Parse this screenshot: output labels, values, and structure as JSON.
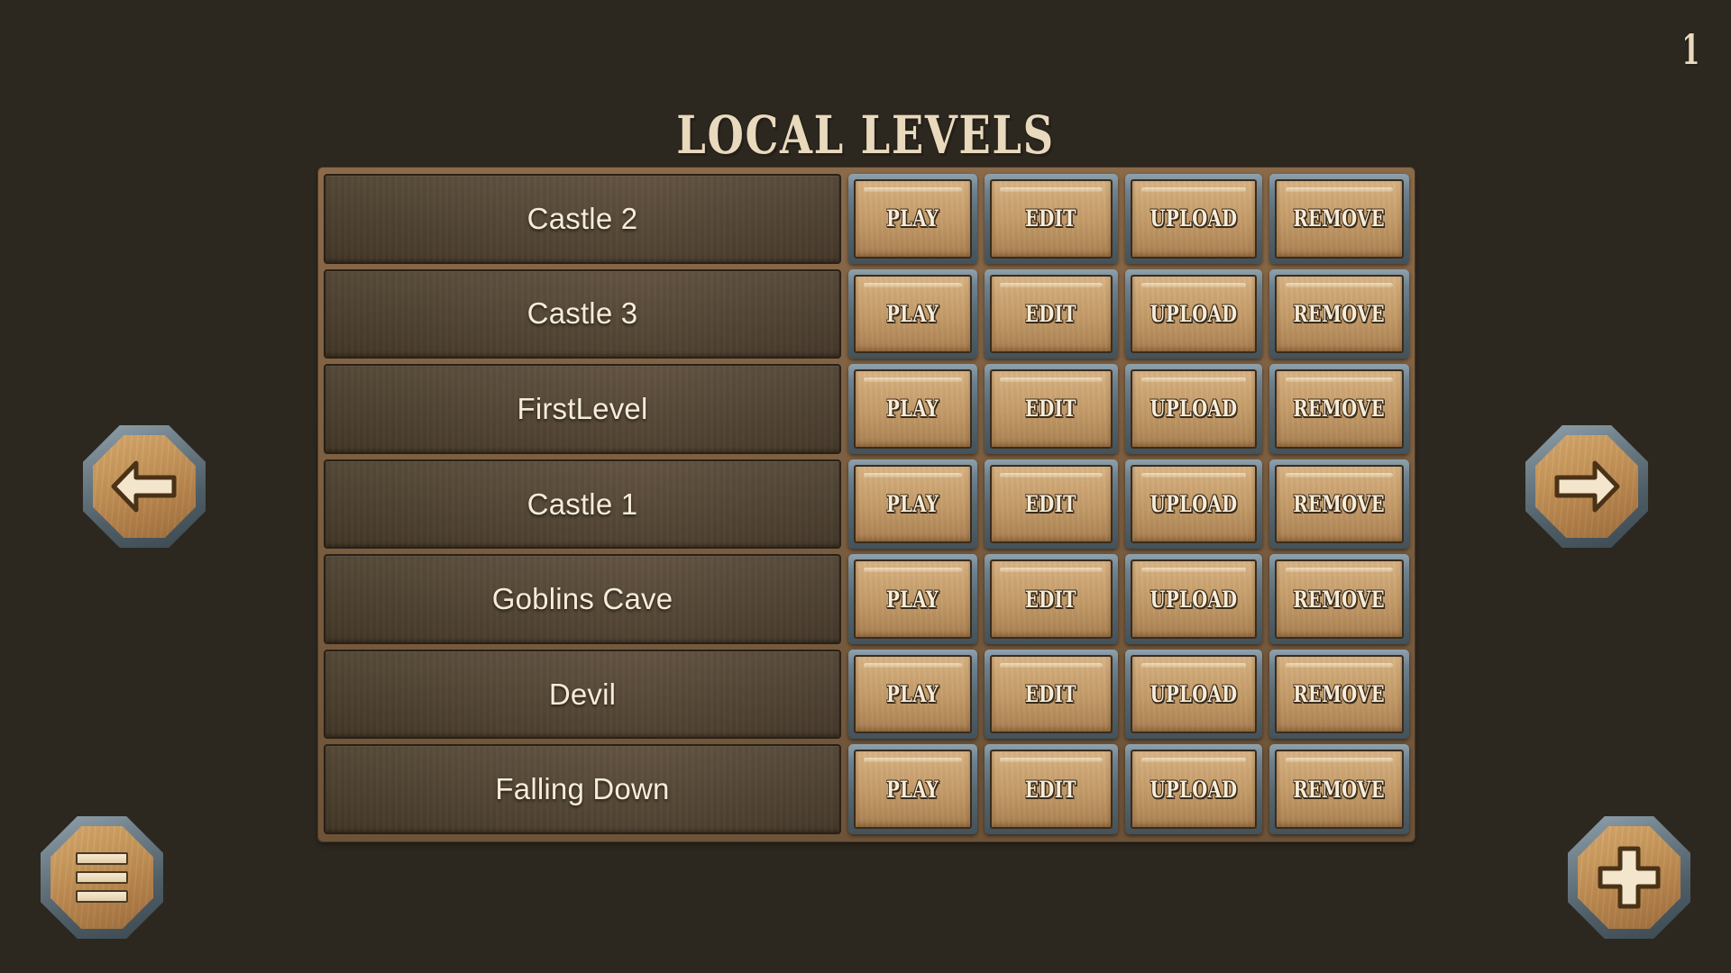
{
  "theme": {
    "background": "#2c2820",
    "panel_frame": "#7b5e40",
    "row_plate": "#564735",
    "button_frame": "#6e8290",
    "button_face": "#cfa877",
    "text_cream": "#f6ecd9",
    "text_outline": "#3a2b1b"
  },
  "header": {
    "title": "LOCAL LEVELS",
    "page_number": "1"
  },
  "actions": {
    "play": "PLAY",
    "edit": "EDIT",
    "upload": "UPLOAD",
    "remove": "REMOVE"
  },
  "nav": {
    "prev_icon": "arrow-left-icon",
    "next_icon": "arrow-right-icon",
    "menu_icon": "hamburger-menu-icon",
    "add_icon": "plus-icon"
  },
  "levels": [
    {
      "name": "Castle 2"
    },
    {
      "name": "Castle 3"
    },
    {
      "name": "FirstLevel"
    },
    {
      "name": "Castle 1"
    },
    {
      "name": "Goblins Cave"
    },
    {
      "name": "Devil"
    },
    {
      "name": "Falling Down"
    }
  ]
}
